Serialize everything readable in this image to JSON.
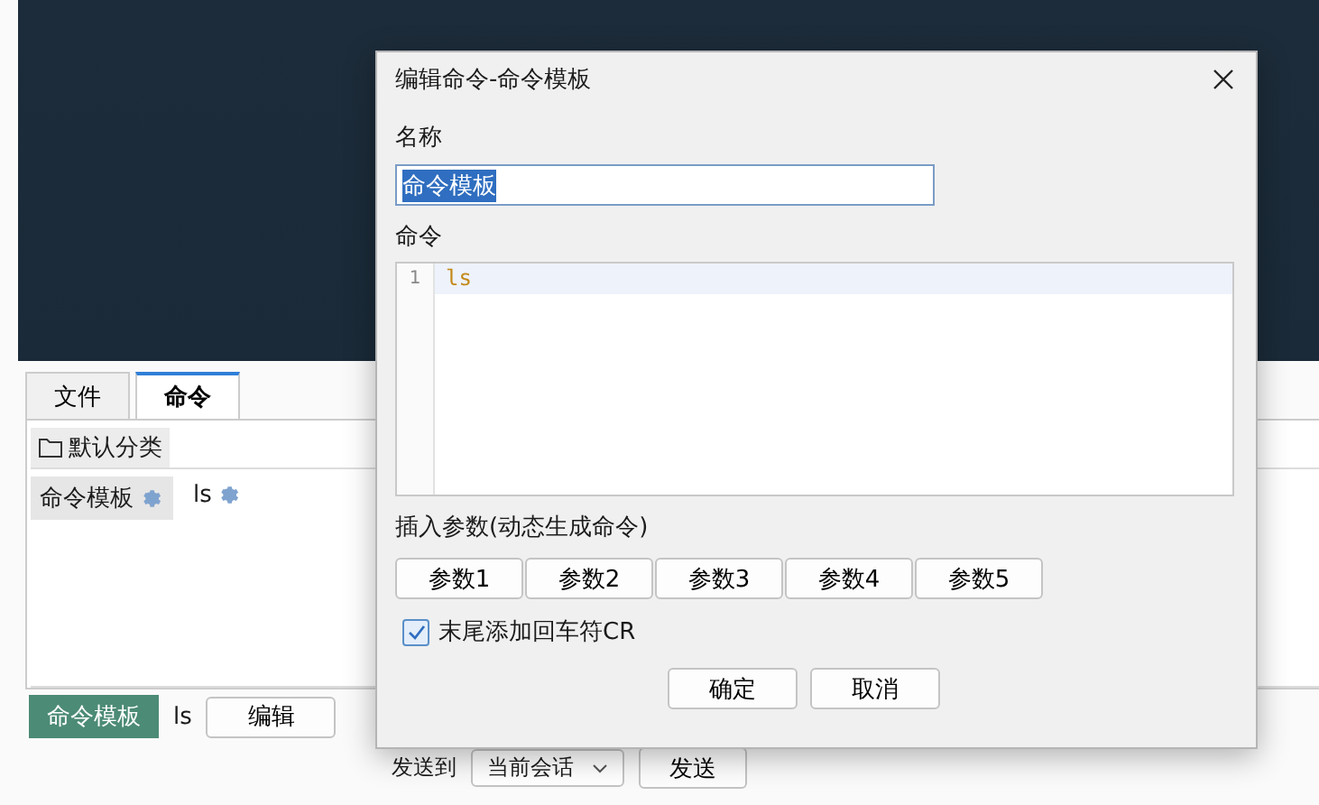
{
  "app": {
    "tabs": [
      {
        "label": "文件",
        "selected": false
      },
      {
        "label": "命令",
        "selected": true
      }
    ],
    "category": "默认分类",
    "commands": [
      {
        "name": "命令模板",
        "selected": true
      },
      {
        "name": "ls",
        "selected": false
      }
    ],
    "current": {
      "name": "命令模板",
      "command": "ls",
      "edit_button": "编辑"
    },
    "send": {
      "label": "发送到",
      "target": "当前会话",
      "button": "发送"
    }
  },
  "dialog": {
    "title": "编辑命令-命令模板",
    "name_label": "名称",
    "name_value": "命令模板",
    "command_label": "命令",
    "lines": [
      {
        "number": "1",
        "text": "ls"
      }
    ],
    "params_label": "插入参数(动态生成命令)",
    "params": [
      "参数1",
      "参数2",
      "参数3",
      "参数4",
      "参数5"
    ],
    "append_cr": {
      "label": "末尾添加回车符CR",
      "checked": true
    },
    "buttons": [
      "确定",
      "取消"
    ]
  }
}
